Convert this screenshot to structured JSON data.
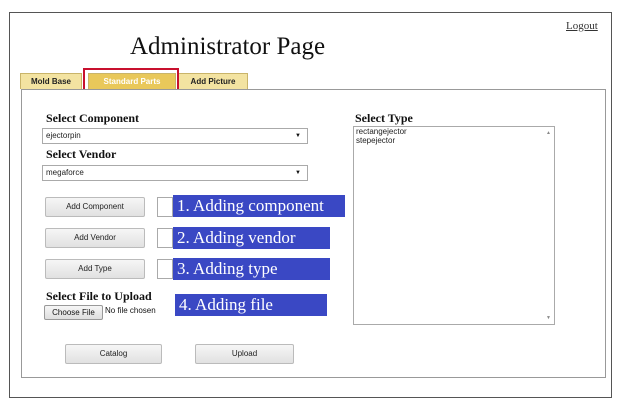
{
  "header": {
    "logout": "Logout",
    "title": "Administrator Page"
  },
  "tabs": [
    {
      "label": "Mold Base"
    },
    {
      "label": "Standard Parts"
    },
    {
      "label": "Add Picture"
    }
  ],
  "form": {
    "component_label": "Select Component",
    "component_value": "ejectorpin",
    "vendor_label": "Select Vendor",
    "vendor_value": "megaforce",
    "add_component": "Add Component",
    "add_vendor": "Add Vendor",
    "add_type": "Add Type",
    "file_label": "Select File to Upload",
    "choose_file": "Choose File",
    "file_status": "No file chosen",
    "catalog": "Catalog",
    "upload": "Upload"
  },
  "type_panel": {
    "label": "Select Type",
    "options": [
      "rectangejector",
      "stepejector"
    ]
  },
  "callouts": [
    "1. Adding component",
    "2. Adding vendor",
    "3. Adding type",
    "4. Adding file"
  ],
  "colors": {
    "callout": "#3a48c4",
    "tab": "#f3e3a1",
    "tab_active": "#e9c85a",
    "highlight": "#c8102e"
  },
  "icons": {
    "dropdown": "▼",
    "scroll_up": "▲",
    "scroll_down": "▼"
  }
}
